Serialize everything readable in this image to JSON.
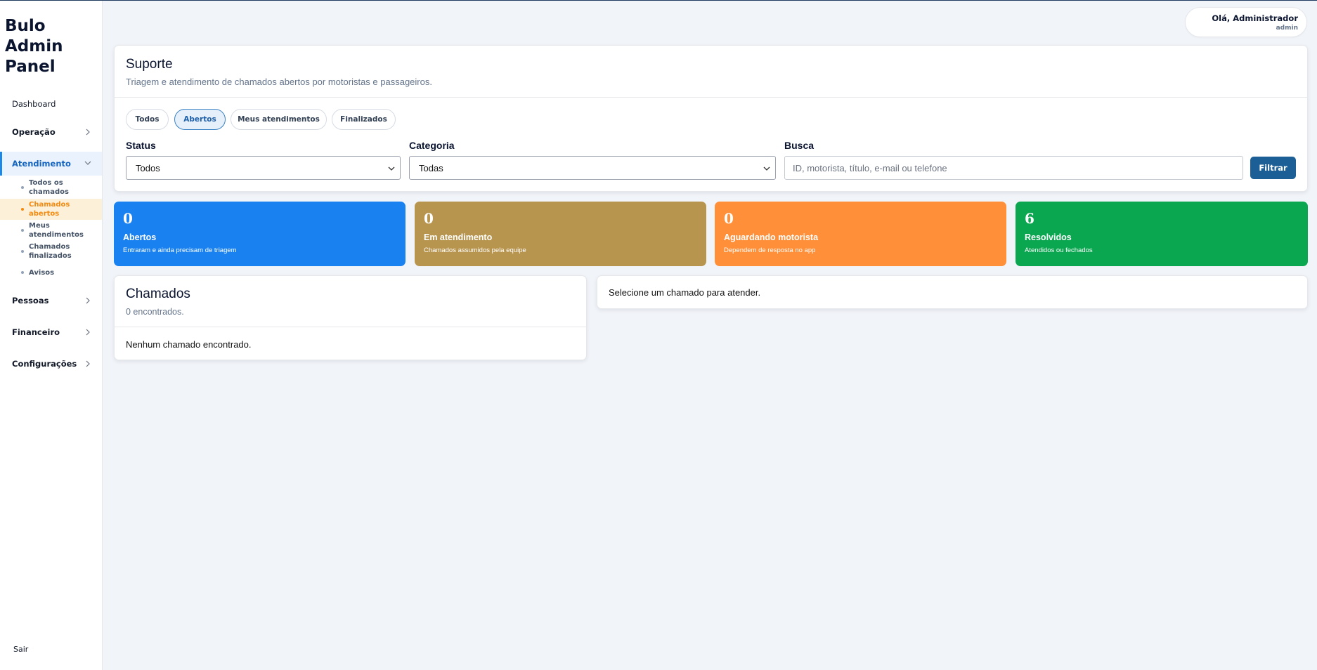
{
  "sidebar": {
    "brand": "Bulo Admin Panel",
    "items": {
      "dashboard": "Dashboard",
      "operacao": "Operação",
      "atendimento": "Atendimento",
      "pessoas": "Pessoas",
      "financeiro": "Financeiro",
      "configuracoes": "Configurações"
    },
    "subitems": [
      "Todos os chamados",
      "Chamados abertos",
      "Meus atendimentos",
      "Chamados finalizados",
      "Avisos"
    ],
    "logout": "Sair"
  },
  "header": {
    "greeting": "Olá, Administrador",
    "role": "admin"
  },
  "support": {
    "title": "Suporte",
    "subtitle": "Triagem e atendimento de chamados abertos por motoristas e passageiros.",
    "tabs": [
      "Todos",
      "Abertos",
      "Meus atendimentos",
      "Finalizados"
    ],
    "active_tab": "Abertos",
    "status_label": "Status",
    "status_value": "Todos",
    "category_label": "Categoria",
    "category_value": "Todas",
    "search_label": "Busca",
    "search_placeholder": "ID, motorista, título, e-mail ou telefone",
    "filter_button": "Filtrar"
  },
  "stats": [
    {
      "value": "0",
      "label": "Abertos",
      "desc": "Entraram e ainda precisam de triagem",
      "color": "#1a82f0"
    },
    {
      "value": "0",
      "label": "Em atendimento",
      "desc": "Chamados assumidos pela equipe",
      "color": "#b8954e"
    },
    {
      "value": "0",
      "label": "Aguardando motorista",
      "desc": "Dependem de resposta no app",
      "color": "#ff8f38"
    },
    {
      "value": "6",
      "label": "Resolvidos",
      "desc": "Atendidos ou fechados",
      "color": "#0aa750"
    }
  ],
  "tickets": {
    "title": "Chamados",
    "count": "0 encontrados.",
    "empty": "Nenhum chamado encontrado."
  },
  "detail": {
    "placeholder": "Selecione um chamado para atender."
  }
}
